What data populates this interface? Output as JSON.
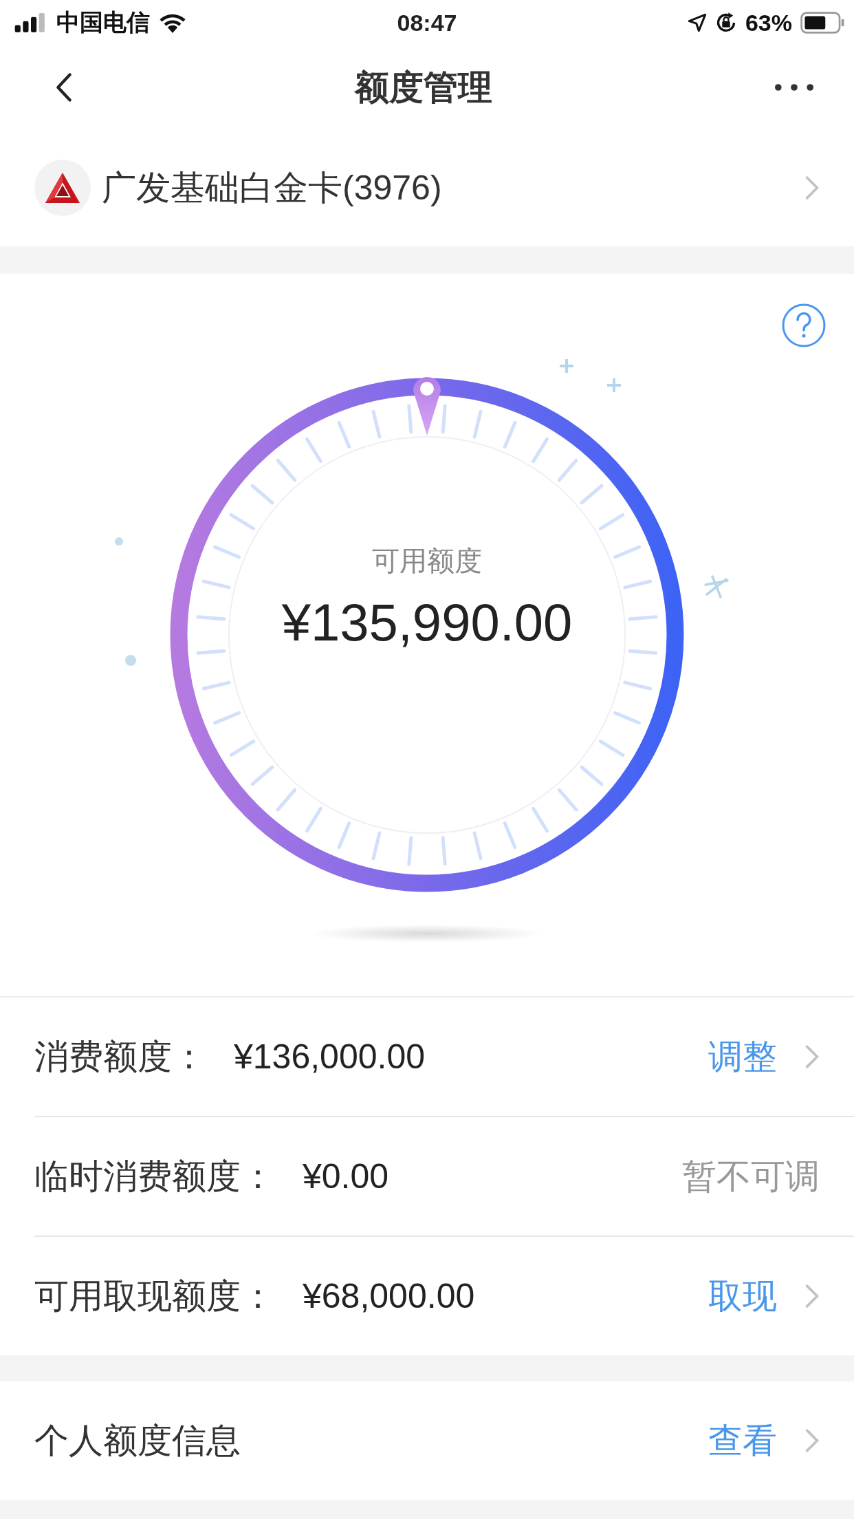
{
  "status_bar": {
    "carrier": "中国电信",
    "time": "08:47",
    "battery": "63%"
  },
  "nav": {
    "title": "额度管理"
  },
  "card": {
    "name": "广发基础白金卡(3976)"
  },
  "gauge": {
    "label": "可用额度",
    "amount": "¥135,990.00"
  },
  "limits": [
    {
      "label": "消费额度：",
      "value": "¥136,000.00",
      "action": "调整",
      "disabled": false
    },
    {
      "label": "临时消费额度：",
      "value": "¥0.00",
      "action": "暂不可调",
      "disabled": true
    },
    {
      "label": "可用取现额度：",
      "value": "¥68,000.00",
      "action": "取现",
      "disabled": false
    }
  ],
  "info": {
    "label": "个人额度信息",
    "action": "查看"
  }
}
